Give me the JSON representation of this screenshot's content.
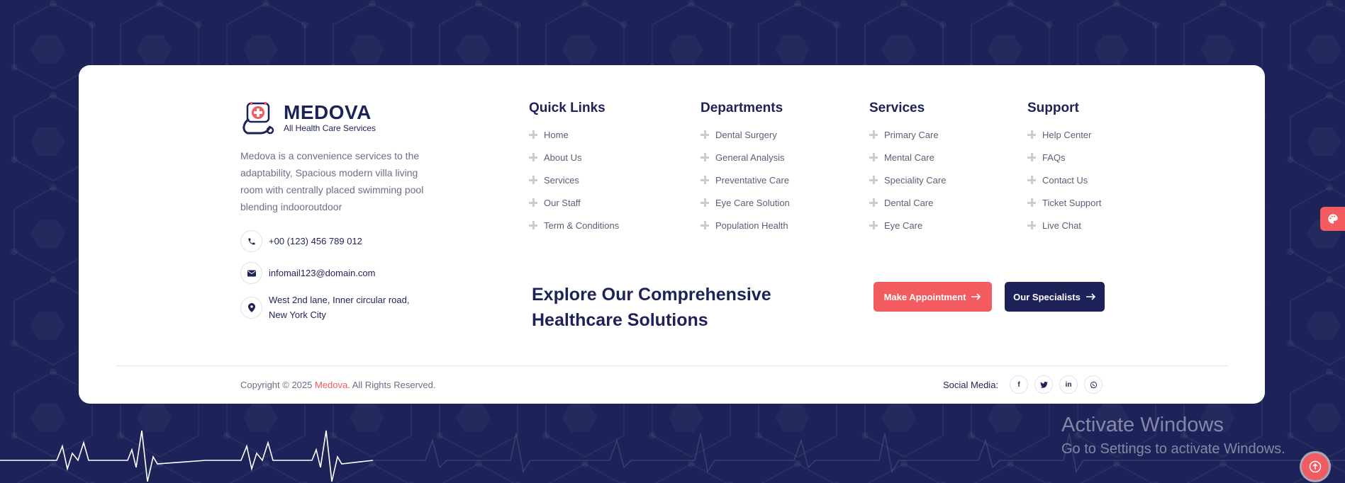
{
  "brand": {
    "name": "MEDOVA",
    "tagline": "All Health Care Services"
  },
  "about": {
    "description": "Medova is a convenience services to the adaptability, Spacious modern villa living room with centrally placed swimming pool blending indooroutdoor"
  },
  "contact": {
    "phone": "+00 (123) 456 789 012",
    "email": "infomail123@domain.com",
    "address_line1": "West 2nd lane, Inner circular road,",
    "address_line2": "New York City"
  },
  "quick_links": {
    "title": "Quick Links",
    "items": [
      "Home",
      "About Us",
      "Services",
      "Our Staff",
      "Term & Conditions"
    ]
  },
  "departments": {
    "title": "Departments",
    "items": [
      "Dental Surgery",
      "General Analysis",
      "Preventative Care",
      "Eye Care Solution",
      "Population Health"
    ]
  },
  "services": {
    "title": "Services",
    "items": [
      "Primary Care",
      "Mental Care",
      "Speciality Care",
      "Dental Care",
      "Eye Care"
    ]
  },
  "support": {
    "title": "Support",
    "items": [
      "Help Center",
      "FAQs",
      "Contact Us",
      "Ticket Support",
      "Live Chat"
    ]
  },
  "cta": {
    "heading_line1": "Explore Our Comprehensive",
    "heading_line2": "Healthcare Solutions",
    "appointment_label": "Make Appointment",
    "specialists_label": "Our Specialists"
  },
  "footer": {
    "copyright_prefix": "Copyright © 2025 ",
    "copyright_brand": "Medova",
    "copyright_suffix": ". All Rights Reserved.",
    "social_label": "Social Media:",
    "social_icons": [
      "facebook-icon",
      "twitter-icon",
      "linkedin-icon",
      "whatsapp-icon"
    ]
  },
  "watermark": {
    "title": "Activate Windows",
    "subtitle": "Go to Settings to activate Windows."
  },
  "colors": {
    "navy": "#1d2358",
    "accent": "#f25b60",
    "card": "#ffffff",
    "muted_text": "#6b6f86"
  }
}
